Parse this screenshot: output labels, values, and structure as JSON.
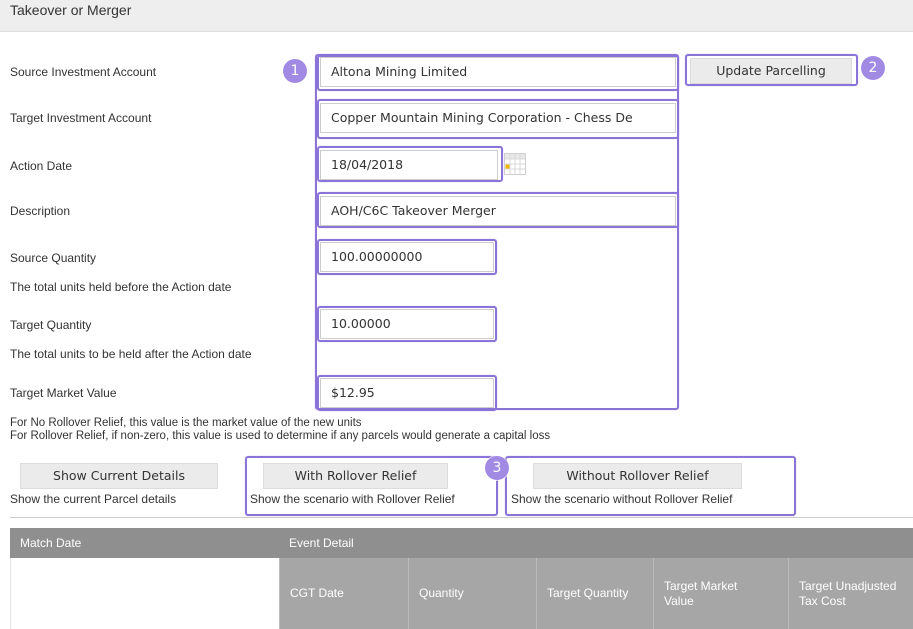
{
  "header": {
    "title": "Takeover or Merger"
  },
  "form": {
    "source_account": {
      "label": "Source Investment Account",
      "value": "Altona Mining Limited"
    },
    "update_button": "Update Parcelling",
    "target_account": {
      "label": "Target Investment Account",
      "value": "Copper Mountain Mining Corporation - Chess De"
    },
    "action_date": {
      "label": "Action Date",
      "value": "18/04/2018"
    },
    "description": {
      "label": "Description",
      "value": "AOH/C6C Takeover Merger"
    },
    "source_quantity": {
      "label": "Source Quantity",
      "value": "100.00000000",
      "help": "The total units held before the Action date"
    },
    "target_quantity": {
      "label": "Target Quantity",
      "value": "10.00000",
      "help": "The total units to be held after the Action date"
    },
    "target_market_value": {
      "label": "Target Market Value",
      "value": "$12.95"
    },
    "notes": [
      "For No Rollover Relief, this value is the market value of the new units",
      "For Rollover Relief, if non-zero, this value is used to determine if any parcels would generate a capital loss"
    ]
  },
  "actions": {
    "show_current": {
      "label": "Show Current Details",
      "help": "Show the current Parcel details"
    },
    "with_rollover": {
      "label": "With Rollover Relief",
      "help": "Show the scenario with Rollover Relief"
    },
    "without_rollover": {
      "label": "Without Rollover Relief",
      "help": "Show the scenario without Rollover Relief"
    }
  },
  "badges": [
    "1",
    "2",
    "3"
  ],
  "table": {
    "headers": [
      "Match Date",
      "Event Detail"
    ],
    "sub_headers": [
      "CGT Date",
      "Quantity",
      "Target Quantity",
      "Target Market Value",
      "Target Unadjusted Tax Cost"
    ]
  },
  "colors": {
    "highlight": "#8b74d8",
    "badge": "#a18ae4",
    "table_header": "#8f8f8f",
    "table_subheader": "#a6a6a6"
  },
  "icons": {
    "calendar": "calendar-icon"
  }
}
